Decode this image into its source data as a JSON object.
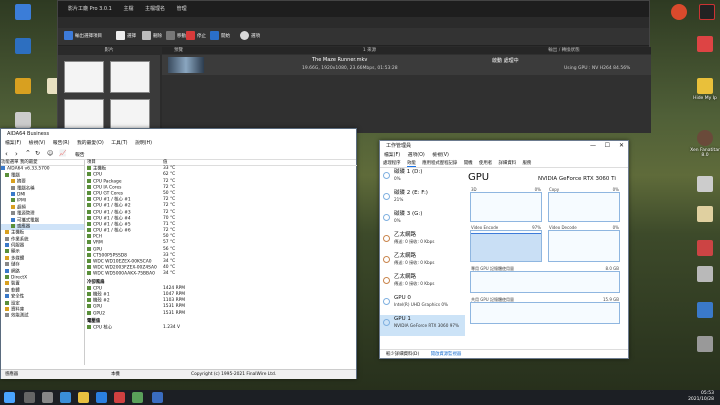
{
  "desktop": {
    "icons_left": [
      "",
      "",
      "",
      "",
      "",
      ""
    ],
    "icons_right": [
      "",
      "",
      "Hide My Ip",
      "",
      "Xen Fanatitar 8.0",
      "",
      "",
      "",
      "",
      ""
    ]
  },
  "converter": {
    "title": "影片工廠 Pro 3.0.1",
    "menu": [
      "主檔",
      "主檔理名",
      "管理"
    ],
    "toolbar": {
      "add_label": "輸出選擇項目",
      "choose_label": "選擇",
      "delete_label": "刪除",
      "move_label": "移動",
      "stop_label": "停止",
      "start_label": "開始",
      "settings_label": "選項"
    },
    "left_header": "影片",
    "left_tiles": [
      "",
      "",
      "",
      ""
    ],
    "columns": {
      "preview": "預覽",
      "source": "1 來源",
      "output": "輸出 / 轉換狀態"
    },
    "item": {
      "title": "The Maze Runner.mkv",
      "meta": "19.66G, 1920x1080, 23.66Mbps, 01:53:28",
      "state": "啟動 處理中",
      "gpu": "Using GPU : NV H264 84.56%"
    }
  },
  "aida": {
    "title": "AIDA64 Business",
    "menu": [
      "檔案(F)",
      "檢視(V)",
      "報告(R)",
      "我的最愛(O)",
      "工具(T)",
      "說明(H)"
    ],
    "tool_report": "報告",
    "tabs": [
      "功能選單",
      "我的最愛"
    ],
    "tree": [
      "AIDA64 v6.33.5700",
      "電腦",
      "摘要",
      "電腦名稱",
      "DMI",
      "IPMI",
      "超頻",
      "電源管理",
      "可攜式電腦",
      "感應器",
      "主機板",
      "作業系統",
      "伺服器",
      "顯示",
      "多媒體",
      "儲存",
      "網路",
      "DirectX",
      "裝置",
      "軟體",
      "安全性",
      "設定",
      "資料庫",
      "效能測試"
    ],
    "col_item": "項目",
    "col_value": "值",
    "sensors": [
      [
        "主機板",
        "33 °C"
      ],
      [
        "CPU",
        "62 °C"
      ],
      [
        "CPU Package",
        "72 °C"
      ],
      [
        "CPU IA Cores",
        "72 °C"
      ],
      [
        "CPU GT Cores",
        "50 °C"
      ],
      [
        "CPU #1 / 核心 #1",
        "72 °C"
      ],
      [
        "CPU #1 / 核心 #2",
        "72 °C"
      ],
      [
        "CPU #1 / 核心 #3",
        "72 °C"
      ],
      [
        "CPU #1 / 核心 #4",
        "70 °C"
      ],
      [
        "CPU #1 / 核心 #5",
        "71 °C"
      ],
      [
        "CPU #1 / 核心 #6",
        "72 °C"
      ],
      [
        "PCH",
        "50 °C"
      ],
      [
        "VRM",
        "57 °C"
      ],
      [
        "GPU",
        "56 °C"
      ],
      [
        "CT500P5PSSD8",
        "33 °C"
      ],
      [
        "WDC WD10EZEX-00KSCA0",
        "34 °C"
      ],
      [
        "WDC WD2003FZEX-00Z4SA0",
        "40 °C"
      ],
      [
        "WDC WD5000AAKX-75BBA0",
        "34 °C"
      ]
    ],
    "fans_title": "冷卻風扇",
    "fans": [
      [
        "CPU",
        "1424 RPM"
      ],
      [
        "機殼 #1",
        "1047 RPM"
      ],
      [
        "機殼 #2",
        "1103 RPM"
      ],
      [
        "GPU",
        "1531 RPM"
      ],
      [
        "GPU2",
        "1531 RPM"
      ]
    ],
    "volt_title": "電壓值",
    "volts": [
      [
        "CPU 核心",
        "1.234 V"
      ]
    ],
    "status_left": "感應器",
    "status_mid": "本機",
    "status_right": "Copyright (c) 1995-2021 FinalWire Ltd."
  },
  "taskman": {
    "title": "工作管理員",
    "menu": [
      "檔案(F)",
      "選項(O)",
      "檢視(V)"
    ],
    "tabs": [
      "處理程序",
      "效能",
      "應用程式歷程記錄",
      "開機",
      "使用者",
      "詳細資料",
      "服務"
    ],
    "side": [
      {
        "t1": "磁碟 1 (D:)",
        "t2": "0%"
      },
      {
        "t1": "磁碟 2 (E: F:)",
        "t2": "21%"
      },
      {
        "t1": "磁碟 3 (G:)",
        "t2": "0%"
      },
      {
        "t1": "乙太網路",
        "t2": "傳送: 0  接收: 0 Kbps"
      },
      {
        "t1": "乙太網路",
        "t2": "傳送: 0  接收: 0 Kbps"
      },
      {
        "t1": "乙太網路",
        "t2": "傳送: 0  接收: 0 Kbps"
      },
      {
        "t1": "GPU 0",
        "t2": "Intel(R) UHD Graphics  0%"
      },
      {
        "t1": "GPU 1",
        "t2": "NVIDIA GeForce RTX 3060  97%"
      }
    ],
    "gpu_title": "GPU",
    "gpu_name": "NVIDIA GeForce RTX 3060 Ti",
    "graphs": {
      "g3d": "3D",
      "g3d_pct": "0%",
      "copy": "Copy",
      "copy_pct": "0%",
      "venc": "Video Encode",
      "venc_pct": "97%",
      "vdec": "Video Decode",
      "vdec_pct": "0%",
      "dedicated": "專用 GPU 記憶體使用量",
      "dedicated_max": "8.0 GB",
      "shared": "共用 GPU 記憶體使用量",
      "shared_max": "15.9 GB"
    },
    "footer_less": "較少詳細資料(D)",
    "footer_monitor": "開啟資源監視器"
  },
  "taskbar": {
    "clock_time": "05:53",
    "clock_date": "2021/10/28"
  },
  "colors": {
    "desktop_bg": "#506038",
    "converter_bg": "#2b2b2b",
    "taskbar": "#1c1f24",
    "accent_green": "#5a8f3a",
    "selection": "#cce3f7"
  }
}
